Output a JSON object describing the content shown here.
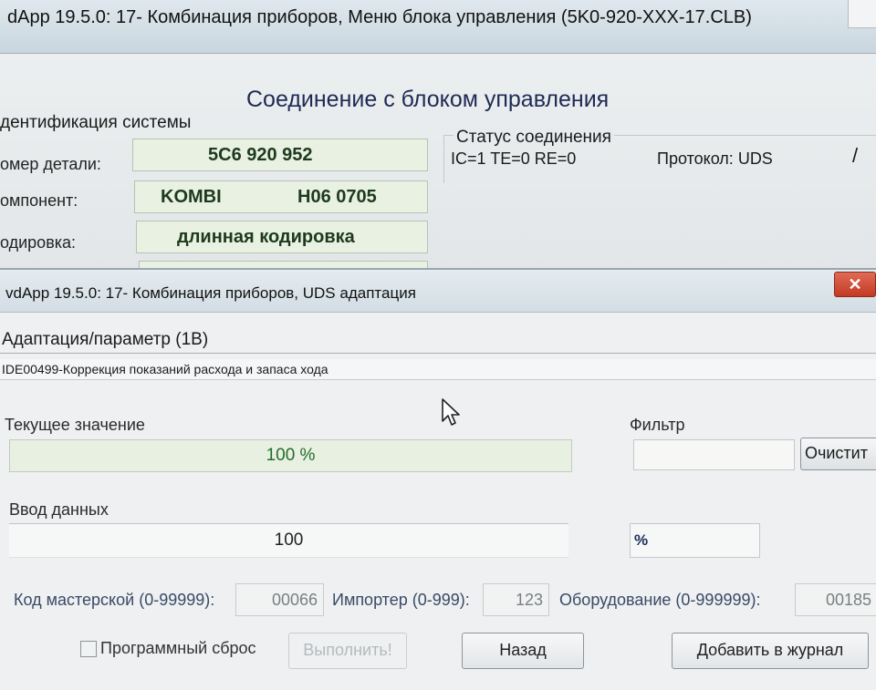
{
  "background_window": {
    "title": "dApp 19.5.0: 17- Комбинация приборов,  Меню блока управления (5K0-920-XXX-17.CLB)",
    "heading": "Соединение с блоком управления",
    "system_id": {
      "group_title": "дентификация системы",
      "part_number_label": "омер детали:",
      "part_number_value": "5C6 920 952",
      "component_label": "омпонент:",
      "component_name": "KOMBI",
      "component_version": "H06 0705",
      "coding_label": "одировка:",
      "coding_value": "длинная кодировка"
    },
    "connection": {
      "title": "Статус соединения",
      "status": "IC=1  TE=0  RE=0",
      "protocol": "Протокол: UDS",
      "indicator": "/"
    }
  },
  "dialog": {
    "title": "vdApp 19.5.0: 17- Комбинация приборов,  UDS адаптация",
    "close_glyph": "✕",
    "adaptation_label": "Адаптация/параметр (1B)",
    "adaptation_value": "IDE00499-Коррекция показаний расхода и запаса хода",
    "current_value_label": "Текущее значение",
    "current_value": "100 %",
    "filter_label": "Фильтр",
    "filter_value": "",
    "clear_button": "Очистит",
    "data_input_label": "Ввод данных",
    "data_input_value": "100",
    "unit": "%",
    "workshop_code_label": "Код мастерской (0-99999):",
    "workshop_code": "00066",
    "importer_label": "Импортер (0-999):",
    "importer": "123",
    "equipment_label": "Оборудование (0-999999):",
    "equipment": "00185",
    "software_reset_label": "Программный сброс",
    "software_reset_checked": false,
    "execute_button": "Выполнить!",
    "back_button": "Назад",
    "add_log_button": "Добавить в журнал"
  },
  "colors": {
    "value_green": "#246b2a",
    "field_green_bg": "#e8f0e2",
    "close_red": "#c43a24"
  }
}
